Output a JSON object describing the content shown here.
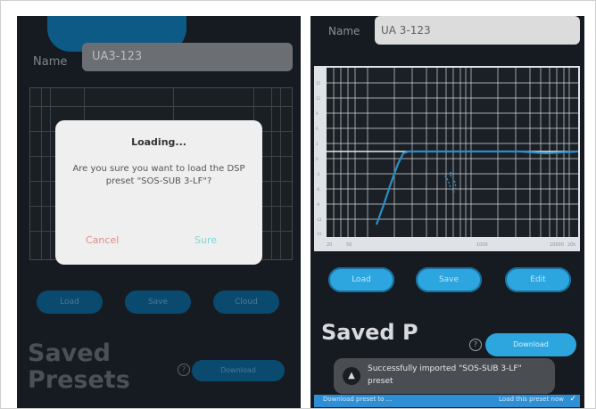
{
  "left_screen": {
    "name_label": "Name",
    "name_value": "UA3-123",
    "buttons": [
      "Load",
      "Save",
      "Cloud"
    ],
    "saved_presets_title": "Saved Presets",
    "help_icon": "?",
    "download_label": "Download",
    "dialog": {
      "title": "Loading...",
      "message": "Are you sure you want to load the DSP preset \"SOS-SUB 3-LF\"?",
      "cancel_label": "Cancel",
      "confirm_label": "Sure"
    }
  },
  "right_screen": {
    "name_label": "Name",
    "name_value": "UA 3-123",
    "graph": {
      "y_ticks": [
        "15",
        "12",
        "9",
        "6",
        "3",
        "0",
        "-3",
        "-6",
        "-9",
        "-12",
        "-15"
      ],
      "x_ticks": [
        "20",
        "50",
        "1000",
        "10000",
        "20k"
      ]
    },
    "buttons": [
      "Load",
      "Save",
      "Edit"
    ],
    "saved_presets_title": "Saved P",
    "help_icon": "?",
    "download_label": "Download",
    "toast": {
      "text": "Successfully imported \"SOS-SUB 3-LF\" preset"
    },
    "bottom_bar": {
      "left_text": "Download preset to ...",
      "right_text": "Load this preset now",
      "check_icon": "check-icon"
    }
  },
  "colors": {
    "background": "#161b21",
    "accent": "#2da6e0",
    "curve": "#2a8fc6",
    "dialog_cancel": "#e38a8a",
    "dialog_confirm": "#7fd6d0"
  }
}
